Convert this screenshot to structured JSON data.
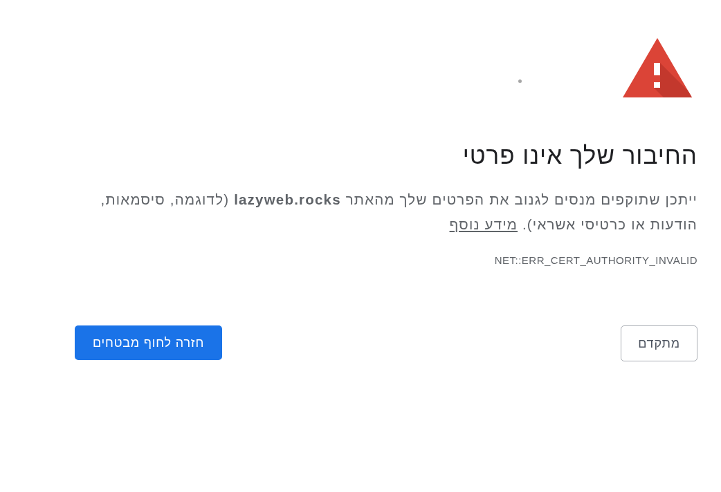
{
  "page": {
    "heading": "החיבור שלך אינו פרטי",
    "message": "ייתכן שתוקפים מנסים לגנוב את הפרטים שלך מהאתר **lazyweb.rocks** (לדוגמה, סיסמאות, הודעות או כרטיסי אשראי).",
    "learn_more_link": "מידע נוסף",
    "error_code": "NET::ERR_CERT_AUTHORITY_INVALID"
  },
  "buttons": [
    {
      "label": "מתקדם",
      "kind": "secondary"
    },
    {
      "label": "חזרה לחוף מבטחים",
      "kind": "primary"
    }
  ]
}
